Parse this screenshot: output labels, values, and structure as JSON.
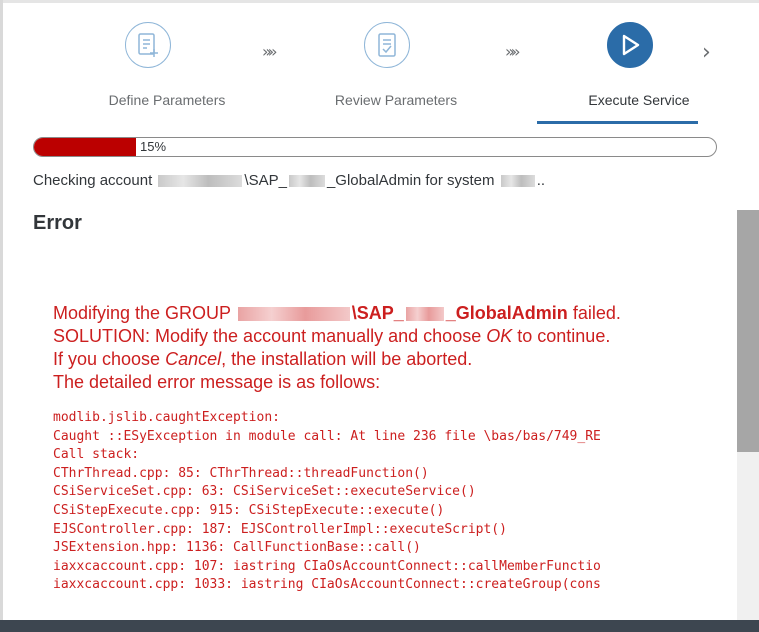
{
  "wizard": {
    "steps": [
      {
        "label": "Define Parameters",
        "icon": "define-parameters-icon",
        "active": false
      },
      {
        "label": "Review Parameters",
        "icon": "review-parameters-icon",
        "active": false
      },
      {
        "label": "Execute Service",
        "icon": "play-icon",
        "active": true
      }
    ],
    "separator": "»",
    "next": "›"
  },
  "progress": {
    "percent": 15,
    "label": "15%"
  },
  "status": {
    "prefix": "Checking account",
    "account_mid": "\\SAP_",
    "account_tail": "_GlobalAdmin for system",
    "suffix": ".."
  },
  "error": {
    "heading": "Error",
    "line1_prefix": "Modifying the GROUP",
    "line1_group": "\\SAP_",
    "line1_group_tail": "_GlobalAdmin",
    "line1_suffix": "failed.",
    "line2_prefix": "SOLUTION: Modify the account manually and choose",
    "line2_ok": "OK",
    "line2_suffix": "to continue.",
    "line3_prefix": "If you choose",
    "line3_cancel": "Cancel",
    "line3_suffix": ", the installation will be aborted.",
    "line4": "The detailed error message is as follows:",
    "trace": [
      "modlib.jslib.caughtException:",
      "Caught ::ESyException in module call: At line 236 file \\bas/bas/749_RE",
      "Call stack:",
      "CThrThread.cpp: 85: CThrThread::threadFunction()",
      "CSiServiceSet.cpp: 63: CSiServiceSet::executeService()",
      "CSiStepExecute.cpp: 915: CSiStepExecute::execute()",
      "EJSController.cpp: 187: EJSControllerImpl::executeScript()",
      "JSExtension.hpp: 1136: CallFunctionBase::call()",
      "iaxxcaccount.cpp: 107: iastring CIaOsAccountConnect::callMemberFunctio",
      "iaxxcaccount.cpp: 1033: iastring CIaOsAccountConnect::createGroup(cons"
    ]
  },
  "colors": {
    "accent": "#2b6ca8",
    "error": "#cc1f1f",
    "progress_fill": "#bb0000"
  }
}
